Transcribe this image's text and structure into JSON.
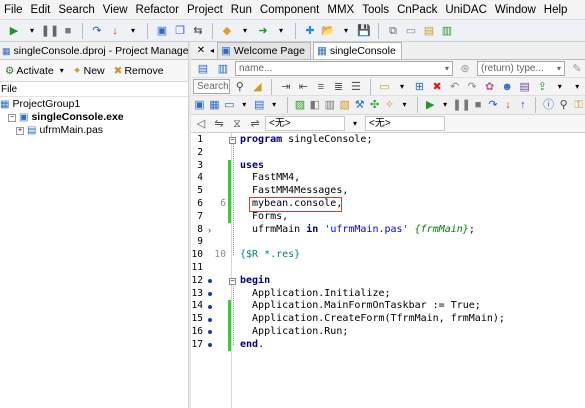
{
  "menu": [
    "File",
    "Edit",
    "Search",
    "View",
    "Refactor",
    "Project",
    "Run",
    "Component",
    "MMX",
    "Tools",
    "CnPack",
    "UniDAC",
    "Window",
    "Help"
  ],
  "left_panel": {
    "tab_title": "singleConsole.dproj - Project Manager",
    "toolbar": {
      "activate": "Activate",
      "new": "New",
      "remove": "Remove"
    },
    "file_header": "File",
    "tree": [
      {
        "label": "ProjectGroup1",
        "level": 0,
        "bold": false
      },
      {
        "label": "singleConsole.exe",
        "level": 1,
        "bold": true
      },
      {
        "label": "ufrmMain.pas",
        "level": 2,
        "bold": false
      }
    ]
  },
  "doc_tabs": [
    "Welcome Page",
    "singleConsole"
  ],
  "nav": {
    "name_placeholder": "name...",
    "return_placeholder": "(return) type...",
    "search_placeholder": "Search..."
  },
  "scope_combos": [
    "<无>",
    "<无>"
  ],
  "icons": {
    "run": "run-icon",
    "save": "save-icon",
    "open": "open-icon"
  },
  "editor": {
    "lines": [
      {
        "n": "1",
        "tokens": [
          [
            "kw",
            "program"
          ],
          [
            "t",
            " singleConsole;"
          ]
        ]
      },
      {
        "n": "",
        "tokens": []
      },
      {
        "n": "",
        "tokens": [
          [
            "kw",
            "uses"
          ]
        ]
      },
      {
        "n": "",
        "tokens": [
          [
            "t",
            "  FastMM4,"
          ]
        ]
      },
      {
        "n": "5",
        "tokens": [
          [
            "t",
            "  FastMM4Messages,"
          ]
        ]
      },
      {
        "n": "6",
        "tokens": [
          [
            "t",
            "  mybean.console,"
          ]
        ]
      },
      {
        "n": "",
        "tokens": [
          [
            "t",
            "  Forms,"
          ]
        ]
      },
      {
        "n": "",
        "tokens": [
          [
            "t",
            "  ufrmMain "
          ],
          [
            "kw",
            "in"
          ],
          [
            "t",
            " "
          ],
          [
            "str",
            "'ufrmMain.pas'"
          ],
          [
            "t",
            " "
          ],
          [
            "cm",
            "{frmMain}"
          ],
          [
            "t",
            ";"
          ]
        ]
      },
      {
        "n": "",
        "tokens": []
      },
      {
        "n": "10",
        "tokens": [
          [
            "dir",
            "{$R *.res}"
          ]
        ]
      },
      {
        "n": "",
        "tokens": []
      },
      {
        "n": "",
        "tokens": [
          [
            "kw",
            "begin"
          ]
        ]
      },
      {
        "n": "",
        "tokens": [
          [
            "t",
            "  Application.Initialize;"
          ]
        ]
      },
      {
        "n": "",
        "tokens": [
          [
            "t",
            "  Application.MainFormOnTaskbar := True;"
          ]
        ]
      },
      {
        "n": "15",
        "tokens": [
          [
            "t",
            "  Application.CreateForm(TfrmMain, frmMain);"
          ]
        ]
      },
      {
        "n": "",
        "tokens": [
          [
            "t",
            "  Application.Run;"
          ]
        ]
      },
      {
        "n": "",
        "tokens": [
          [
            "kw",
            "end"
          ],
          [
            "t",
            "."
          ]
        ]
      }
    ],
    "line_numbers": [
      "1",
      "2",
      "3",
      "4",
      "5",
      "6",
      "7",
      "8",
      "9",
      "10",
      "11",
      "12",
      "13",
      "14",
      "15",
      "16",
      "17"
    ]
  },
  "colors": {
    "keyword": "#000080",
    "string": "#0000ff",
    "comment": "#008000",
    "directive": "#008080",
    "modified_bar": "#2fd22f",
    "breakpoint_dot": "#1a3fa8",
    "highlight_box": "#d23a3a"
  }
}
